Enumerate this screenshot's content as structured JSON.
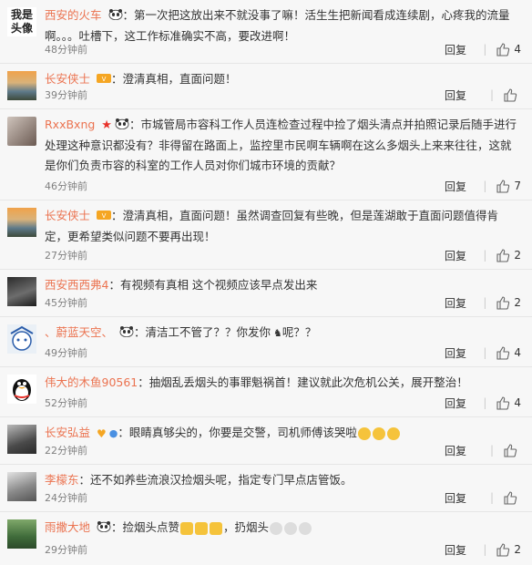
{
  "comments": [
    {
      "user": "西安的火车",
      "text": "：第一次把这放出来不就没事了嘛！活生生把新闻看成连续剧，心疼我的流量啊。。。吐槽下，这工作标准确实不高，要改进啊！",
      "time": "48分钟前",
      "reply": "回复",
      "likes": "4",
      "avatar": "我是头像"
    },
    {
      "user": "长安侠士",
      "text": "：澄清真相，直面问题！",
      "time": "39分钟前",
      "reply": "回复",
      "likes": ""
    },
    {
      "user": "RxxBxng",
      "text": "：市城管局市容科工作人员连检查过程中捡了烟头清点并拍照记录后随手进行处理这种意识都没有？非得留在路面上，监控里市民啊车辆啊在这么多烟头上来来往往，这就是你们负责市容的科室的工作人员对你们城市环境的贡献？",
      "time": "46分钟前",
      "reply": "回复",
      "likes": "7"
    },
    {
      "user": "长安侠士",
      "text": "：澄清真相，直面问题！虽然调查回复有些晚，但是莲湖敢于直面问题值得肯定，更希望类似问题不要再出现！",
      "time": "27分钟前",
      "reply": "回复",
      "likes": "2"
    },
    {
      "user": "西安西西弗4",
      "text": "：有视频有真相 这个视频应该早点发出来",
      "time": "45分钟前",
      "reply": "回复",
      "likes": "2"
    },
    {
      "user": "、蔚蓝天空、",
      "text": "：清洁工不管了？？你发你",
      "text2": "呢？？",
      "time": "49分钟前",
      "reply": "回复",
      "likes": "4"
    },
    {
      "user": "伟大的木鱼90561",
      "text": "：抽烟乱丢烟头的事罪魁祸首！建议就此次危机公关，展开整治！",
      "time": "52分钟前",
      "reply": "回复",
      "likes": "4"
    },
    {
      "user": "长安弘益",
      "text": "：眼睛真够尖的，你要是交警，司机师傅该哭啦",
      "time": "22分钟前",
      "reply": "回复",
      "likes": ""
    },
    {
      "user": "李檬东",
      "text": "：还不如养些流浪汉捡烟头呢，指定专门早点店管饭。",
      "time": "24分钟前",
      "reply": "回复",
      "likes": ""
    },
    {
      "user": "雨撒大地",
      "text": "：捡烟头点赞",
      "text2": "，扔烟头",
      "time": "29分钟前",
      "reply": "回复",
      "likes": "2"
    }
  ],
  "colors": {
    "username": "#eb7350",
    "bg": "#f7f7f7"
  }
}
